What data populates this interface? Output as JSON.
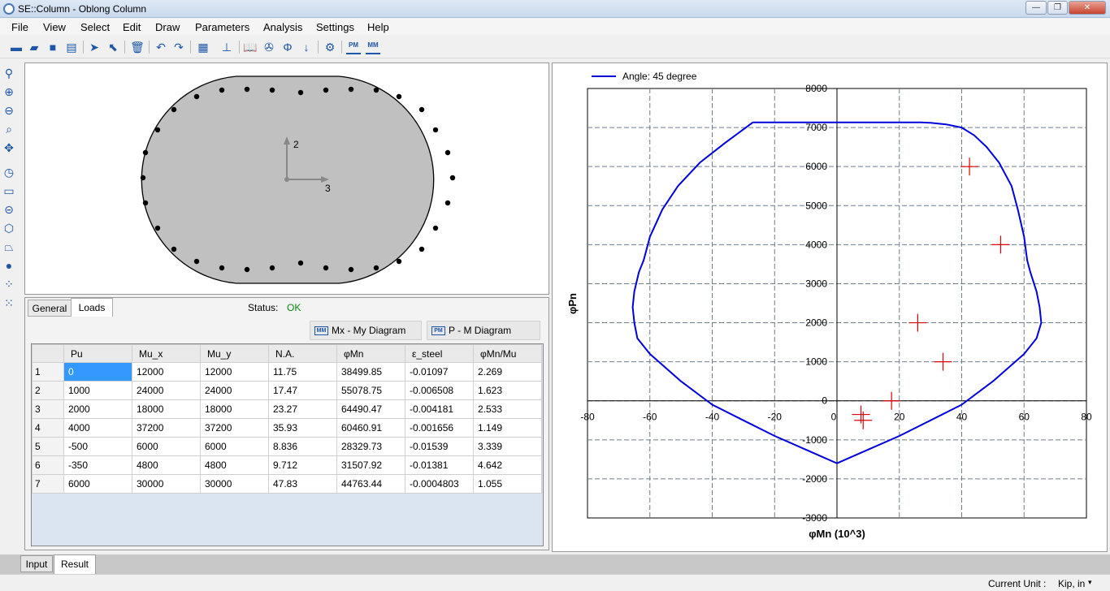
{
  "window": {
    "title": "SE::Column - Oblong Column",
    "minimize_glyph": "—",
    "maximize_glyph": "❐",
    "close_glyph": "✕"
  },
  "menu": [
    "File",
    "View",
    "Select",
    "Edit",
    "Draw",
    "Parameters",
    "Analysis",
    "Settings",
    "Help"
  ],
  "toolbar_pm": "PM",
  "toolbar_mm": "MM",
  "section": {
    "axis_vertical": "2",
    "axis_horizontal": "3"
  },
  "tabs": {
    "general": "General",
    "loads": "Loads"
  },
  "status": {
    "label": "Status:",
    "value": "OK"
  },
  "buttons": {
    "mxmy": "Mx - My Diagram",
    "mxmy_icon": "MM",
    "pm": "P - M Diagram",
    "pm_icon": "PM"
  },
  "table": {
    "headers": [
      "",
      "Pu",
      "Mu_x",
      "Mu_y",
      "N.A.",
      "φMn",
      "ε_steel",
      "φMn/Mu"
    ],
    "rows": [
      [
        "1",
        "0",
        "12000",
        "12000",
        "11.75",
        "38499.85",
        "-0.01097",
        "2.269"
      ],
      [
        "2",
        "1000",
        "24000",
        "24000",
        "17.47",
        "55078.75",
        "-0.006508",
        "1.623"
      ],
      [
        "3",
        "2000",
        "18000",
        "18000",
        "23.27",
        "64490.47",
        "-0.004181",
        "2.533"
      ],
      [
        "4",
        "4000",
        "37200",
        "37200",
        "35.93",
        "60460.91",
        "-0.001656",
        "1.149"
      ],
      [
        "5",
        "-500",
        "6000",
        "6000",
        "8.836",
        "28329.73",
        "-0.01539",
        "3.339"
      ],
      [
        "6",
        "-350",
        "4800",
        "4800",
        "9.712",
        "31507.92",
        "-0.01381",
        "4.642"
      ],
      [
        "7",
        "6000",
        "30000",
        "30000",
        "47.83",
        "44763.44",
        "-0.0004803",
        "1.055"
      ]
    ]
  },
  "chart_data": {
    "type": "line",
    "title": "",
    "legend": "Angle: 45 degree",
    "legend_position": "top-left",
    "xlabel": "φMn (10^3)",
    "ylabel": "φPn",
    "xlim": [
      -80,
      80
    ],
    "ylim": [
      -3000,
      8000
    ],
    "xticks": [
      -80,
      -60,
      -40,
      -20,
      0,
      20,
      40,
      60,
      80
    ],
    "yticks": [
      -3000,
      -2000,
      -1000,
      0,
      1000,
      2000,
      3000,
      4000,
      5000,
      6000,
      7000,
      8000
    ],
    "grid": true,
    "series": [
      {
        "name": "Angle: 45 degree",
        "color": "#0000dd",
        "x": [
          -27,
          -36,
          -44,
          -51,
          -56,
          -60,
          -62,
          -63.5,
          -65,
          -65.5,
          -65,
          -64,
          -60,
          -50,
          -40,
          -30,
          -20,
          -10,
          0,
          10,
          20,
          30,
          40,
          50,
          60,
          64,
          65.5,
          65,
          64,
          62,
          61,
          60,
          58,
          56,
          52,
          48,
          44,
          40,
          35,
          30,
          27,
          -27
        ],
        "y": [
          7130,
          6600,
          6100,
          5500,
          4900,
          4200,
          3600,
          3300,
          2800,
          2400,
          2000,
          1600,
          1200,
          500,
          -100,
          -500,
          -900,
          -1250,
          -1600,
          -1250,
          -900,
          -500,
          -100,
          500,
          1200,
          1600,
          2000,
          2400,
          2800,
          3300,
          3600,
          4200,
          4900,
          5500,
          6100,
          6500,
          6800,
          7000,
          7080,
          7120,
          7130,
          7130
        ]
      }
    ],
    "points": {
      "name": "Load points",
      "color": "#dd0000",
      "x": [
        7.7,
        8.4,
        17.5,
        25.9,
        34.0,
        42.5,
        52.5
      ],
      "y": [
        -350,
        -500,
        0,
        2000,
        1000,
        6000,
        4000
      ]
    }
  },
  "bottom_tabs": {
    "input": "Input",
    "result": "Result"
  },
  "statusbar": {
    "unit_label": "Current Unit :",
    "unit_value": "Kip, in",
    "unit_caret": "▾"
  }
}
